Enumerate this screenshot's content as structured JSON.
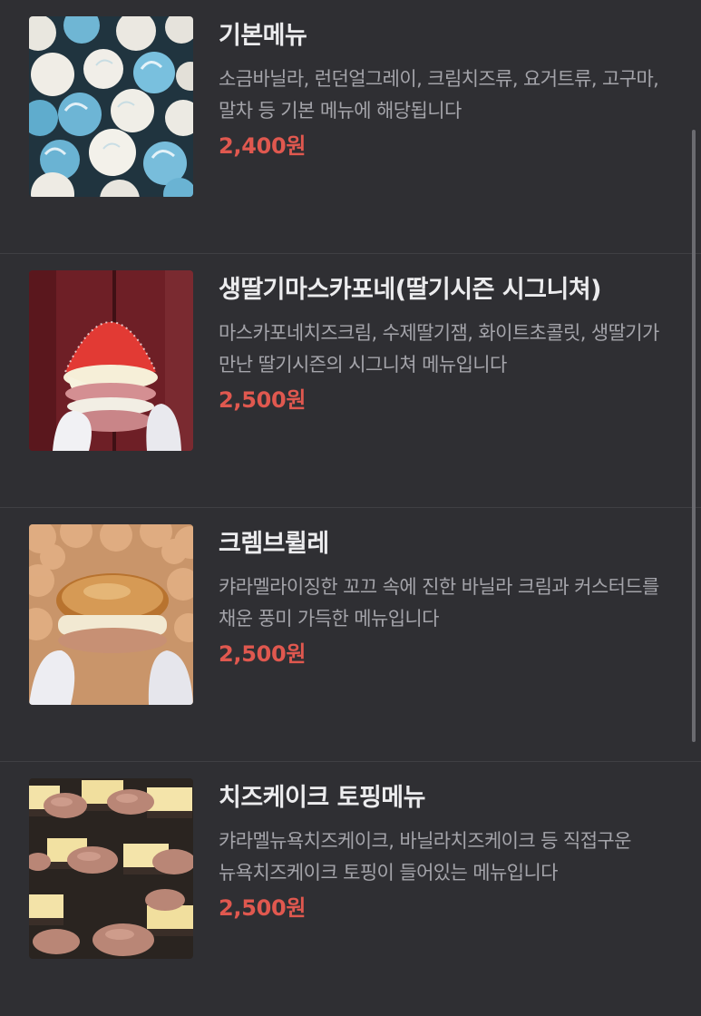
{
  "menu": {
    "items": [
      {
        "title": "기본메뉴",
        "description": "소금바닐라, 런던얼그레이, 크림치즈류, 요거트류, 고구마, 말차 등 기본 메뉴에 해당됩니다",
        "price": "2,400원",
        "image": "blue-white-macarons-photo"
      },
      {
        "title": "생딸기마스카포네(딸기시즌 시그니쳐)",
        "description": "마스카포네치즈크림, 수제딸기잼, 화이트초콜릿, 생딸기가 만난 딸기시즌의 시그니쳐 메뉴입니다",
        "price": "2,500원",
        "image": "strawberry-macaron-photo"
      },
      {
        "title": "크렘브륄레",
        "description": "캬라멜라이징한 꼬끄 속에 진한 바닐라 크림과 커스터드를 채운 풍미 가득한 메뉴입니다",
        "price": "2,500원",
        "image": "creme-brulee-macaron-photo"
      },
      {
        "title": "치즈케이크 토핑메뉴",
        "description": "캬라멜뉴욕치즈케이크, 바닐라치즈케이크 등 직접구운 뉴욕치즈케이크 토핑이 들어있는 메뉴입니다",
        "price": "2,500원",
        "image": "cheesecake-macarons-photo"
      }
    ]
  },
  "colors": {
    "background": "#2f2f33",
    "title": "#ececee",
    "description": "#a4a4aa",
    "price": "#e0584f",
    "divider": "#3f3f44"
  }
}
